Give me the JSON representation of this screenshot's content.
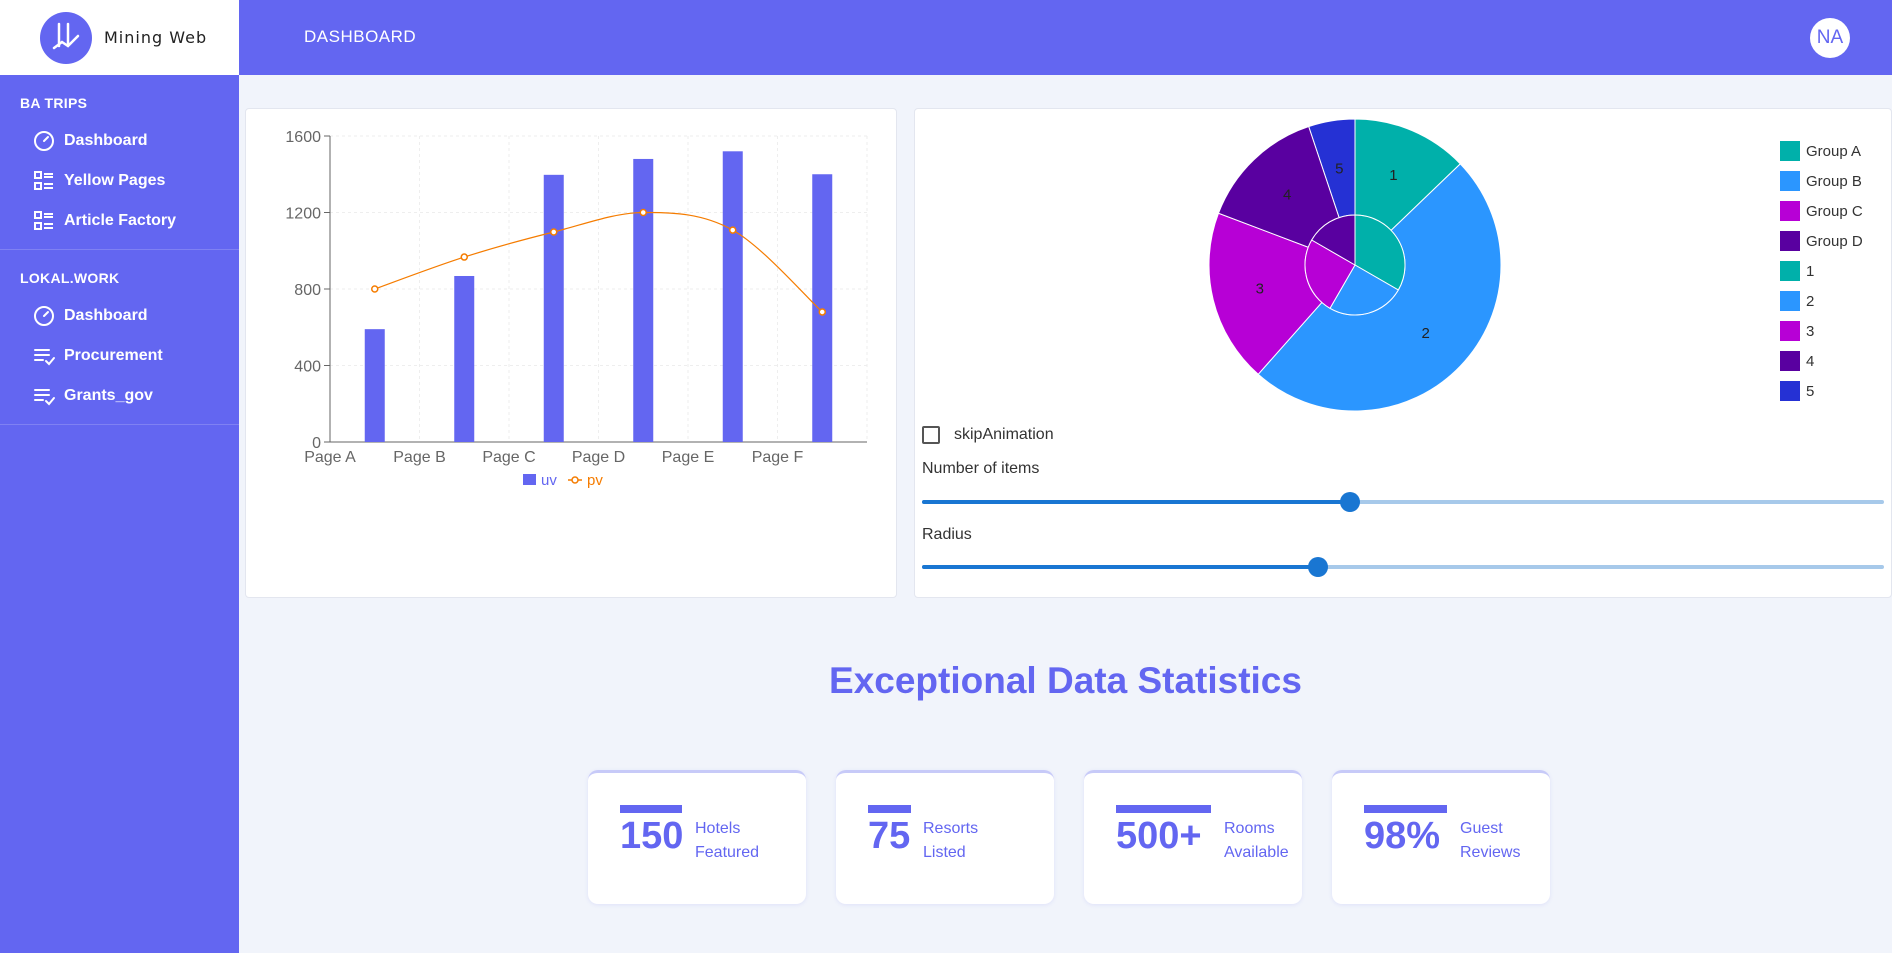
{
  "app": {
    "name": "Mining Web"
  },
  "header": {
    "title": "DASHBOARD",
    "avatar_initials": "NA"
  },
  "sidebar": {
    "sections": [
      {
        "title": "BA TRIPS",
        "items": [
          {
            "label": "Dashboard",
            "icon": "speedometer-icon"
          },
          {
            "label": "Yellow Pages",
            "icon": "list-grid-icon"
          },
          {
            "label": "Article Factory",
            "icon": "list-grid-icon"
          }
        ]
      },
      {
        "title": "LOKAL.WORK",
        "items": [
          {
            "label": "Dashboard",
            "icon": "speedometer-icon"
          },
          {
            "label": "Procurement",
            "icon": "playlist-check-icon"
          },
          {
            "label": "Grants_gov",
            "icon": "playlist-check-icon"
          }
        ]
      }
    ]
  },
  "chart_data": [
    {
      "type": "bar",
      "categories": [
        "Page A",
        "Page B",
        "Page C",
        "Page D",
        "Page E",
        "Page F"
      ],
      "series": [
        {
          "name": "uv",
          "kind": "bar",
          "color": "#6366f1",
          "values": [
            590,
            868,
            1397,
            1480,
            1520,
            1400
          ]
        },
        {
          "name": "pv",
          "kind": "line",
          "color": "#f57c00",
          "values": [
            800,
            967,
            1098,
            1200,
            1108,
            680
          ]
        }
      ],
      "yticks": [
        0,
        400,
        800,
        1200,
        1600
      ],
      "ylim": [
        0,
        1600
      ],
      "grid": true,
      "legend": "bottom"
    },
    {
      "type": "pie",
      "inner": [
        {
          "name": "Group A",
          "value": 400,
          "color": "#00b0aa"
        },
        {
          "name": "Group B",
          "value": 300,
          "color": "#2b96ff"
        },
        {
          "name": "Group C",
          "value": 300,
          "color": "#b700d6"
        },
        {
          "name": "Group D",
          "value": 200,
          "color": "#5900a0"
        }
      ],
      "outer": [
        {
          "name": "1",
          "value": 100,
          "color": "#00b0aa"
        },
        {
          "name": "2",
          "value": 380,
          "color": "#2b96ff"
        },
        {
          "name": "3",
          "value": 150,
          "color": "#b700d6"
        },
        {
          "name": "4",
          "value": 110,
          "color": "#5900a0"
        },
        {
          "name": "5",
          "value": 40,
          "color": "#2531d4"
        }
      ],
      "legend": "right"
    }
  ],
  "controls": {
    "skip_animation_label": "skipAnimation",
    "skip_animation_checked": false,
    "items_label": "Number of items",
    "items_fraction": 0.445,
    "radius_label": "Radius",
    "radius_fraction": 0.412
  },
  "stats": {
    "title": "Exceptional Data Statistics",
    "items": [
      {
        "value": "150",
        "line1": "Hotels",
        "line2": "Featured"
      },
      {
        "value": "75",
        "line1": "Resorts",
        "line2": "Listed"
      },
      {
        "value": "500+",
        "line1": "Rooms",
        "line2": "Available"
      },
      {
        "value": "98%",
        "line1": "Guest",
        "line2": "Reviews"
      }
    ]
  }
}
